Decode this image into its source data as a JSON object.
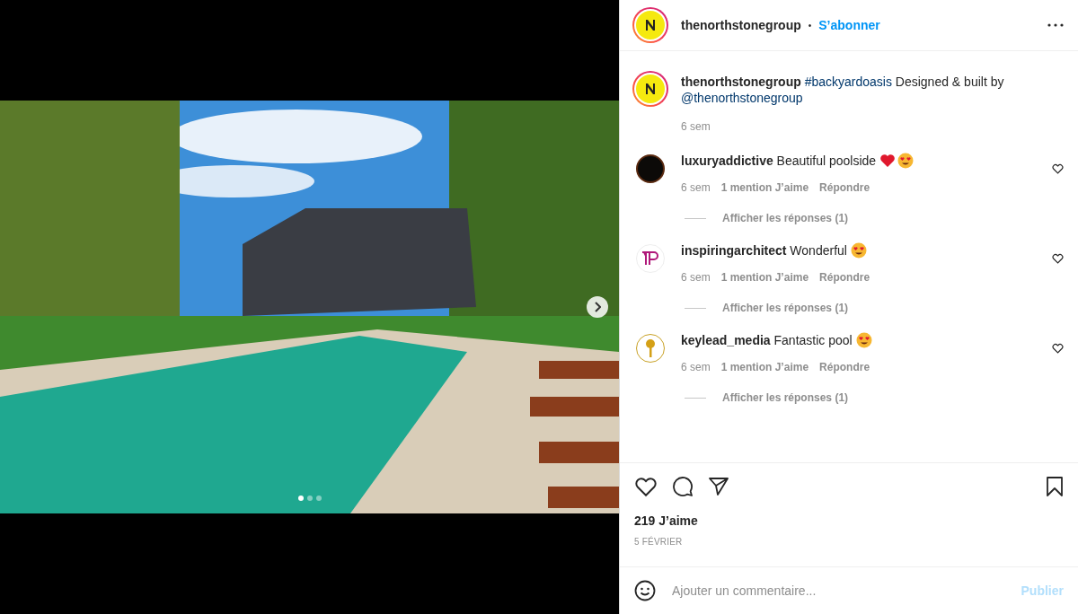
{
  "post": {
    "photo": {
      "dots": [
        {
          "selected": true
        },
        {
          "selected": false
        },
        {
          "selected": false
        }
      ]
    }
  },
  "header": {
    "username": "thenorthstonegroup",
    "separator": "•",
    "follow": "S’abonner"
  },
  "caption": {
    "username": "thenorthstonegroup",
    "parts": [
      {
        "kind": "link",
        "text": "#backyardoasis"
      },
      {
        "kind": "text",
        "text": "Designed & built by"
      },
      {
        "kind": "link",
        "text": "@thenorthstonegroup"
      }
    ],
    "time": "6 sem"
  },
  "comments": [
    {
      "kind": "dark_avatar",
      "username": "luxuryaddictive",
      "text": "Beautiful poolside",
      "emojis": [
        {
          "kind": "heart"
        },
        {
          "kind": "heart_eyes"
        }
      ],
      "time": "6 sem",
      "likes": "1 mention J’aime",
      "reply": "Répondre",
      "replies": "Afficher les réponses (1)"
    },
    {
      "kind": "monogram_avatar",
      "username": "inspiringarchitect",
      "text": "Wonderful",
      "emojis": [
        {
          "kind": "heart_eyes"
        }
      ],
      "time": "6 sem",
      "likes": "1 mention J’aime",
      "reply": "Répondre",
      "replies": "Afficher les réponses (1)"
    },
    {
      "kind": "key_avatar",
      "username": "keylead_media",
      "text": "Fantastic pool",
      "emojis": [
        {
          "kind": "heart_eyes"
        }
      ],
      "time": "6 sem",
      "likes": "1 mention J’aime",
      "reply": "Répondre",
      "replies": "Afficher les réponses (1)"
    }
  ],
  "likes": "219 J’aime",
  "date": "5 FÉVRIER",
  "comment_box": {
    "placeholder": "Ajouter un commentaire...",
    "submit": "Publier"
  }
}
